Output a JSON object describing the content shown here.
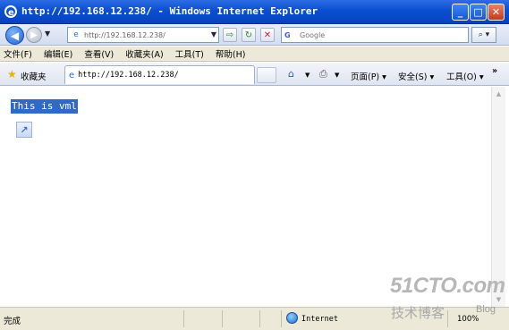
{
  "window": {
    "title": "http://192.168.12.238/ - Windows Internet Explorer",
    "minimize_glyph": "_",
    "maximize_glyph": "□",
    "close_glyph": "✕"
  },
  "address_bar": {
    "url": "http://192.168.12.238/",
    "icons": [
      "back-icon",
      "forward-icon",
      "go-icon",
      "refresh-icon",
      "stop-icon"
    ]
  },
  "search": {
    "placeholder": "Google",
    "provider_glyph": "G"
  },
  "menu": {
    "items": [
      "文件(F)",
      "编辑(E)",
      "查看(V)",
      "收藏夹(A)",
      "工具(T)",
      "帮助(H)"
    ]
  },
  "favorites": {
    "label": "收藏夹"
  },
  "tab": {
    "label": "http://192.168.12.238/"
  },
  "command_bar": {
    "page": "页面(P) ▾",
    "safety": "安全(S) ▾",
    "tools": "工具(O) ▾",
    "more": "»"
  },
  "content": {
    "text": "This is vml"
  },
  "status": {
    "text": "完成",
    "zone": "Internet",
    "zoom": "100%"
  },
  "watermark": {
    "brand": "51CTO.com",
    "subtitle": "技术博客",
    "blog": "Blog"
  },
  "colors": {
    "title_bar": "#0a4fd0",
    "selection": "#316ac5",
    "chrome": "#ece9d8"
  }
}
